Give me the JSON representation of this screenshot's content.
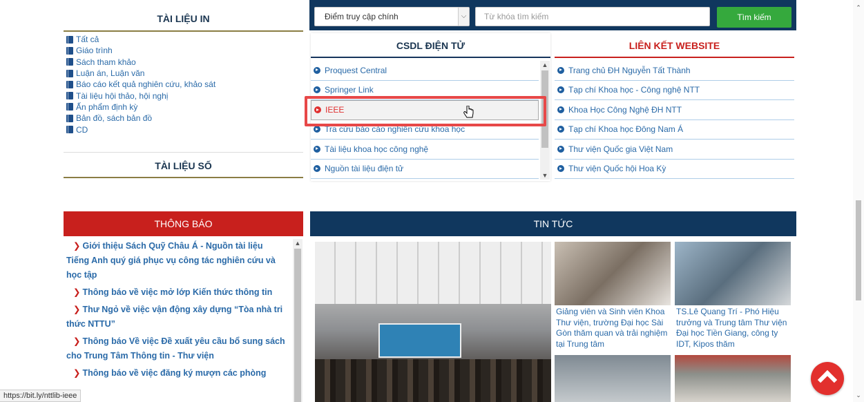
{
  "print_docs": {
    "title": "TÀI LIỆU IN",
    "items": [
      "Tất cả",
      "Giáo trình",
      "Sách tham khảo",
      "Luận án, Luận văn",
      "Báo cáo kết quả nghiên cứu, khảo sát",
      "Tài liệu hội thảo, hội nghị",
      "Ấn phẩm định kỳ",
      "Bản đồ, sách bản đồ",
      "CD"
    ]
  },
  "digital_docs": {
    "title": "TÀI LIỆU SỐ"
  },
  "search": {
    "scope_selected": "Điểm truy cập chính",
    "keyword_placeholder": "Từ khóa tìm kiếm",
    "button_label": "Tìm kiếm"
  },
  "csdl": {
    "title": "CSDL ĐIỆN TỬ",
    "items": [
      "Proquest Central",
      "Springer Link",
      "IEEE",
      "Tra cứu báo cáo nghiên cứu khoa học",
      "Tài liệu khoa học công nghệ",
      "Nguồn tài liệu điện tử"
    ],
    "highlighted": "IEEE"
  },
  "links": {
    "title": "LIÊN KẾT WEBSITE",
    "items": [
      "Trang chủ ĐH Nguyễn Tất Thành",
      "Tạp chí Khoa học - Công nghệ NTT",
      "Khoa Học Công Nghệ ĐH NTT",
      "Tạp chí Khoa học Đông Nam Á",
      "Thư viện Quốc gia Việt Nam",
      "Thư viện Quốc hội Hoa Kỳ"
    ]
  },
  "notices": {
    "title": "THÔNG BÁO",
    "items": [
      "Giới thiệu Sách Quỹ Châu Á - Nguồn tài liệu Tiếng Anh quý giá phục vụ công tác nghiên cứu và học tập",
      "Thông báo về việc mở lớp Kiến thức thông tin",
      "Thư Ngỏ về việc vận động xây dựng “Tòa nhà tri thức NTTU”",
      "Thông báo Về việc Đề xuất yêu cầu bổ sung sách cho Trung Tâm Thông tin - Thư viện",
      "Thông báo về việc đăng ký mượn các phòng"
    ]
  },
  "news": {
    "title": "TIN TỨC",
    "captions": [
      "Giảng viên và Sinh viên Khoa Thư viện, trường Đại học Sài Gòn thăm quan và trải nghiệm tại Trung tâm",
      "TS.Lê Quang Trí - Phó Hiệu trưởng và Trung tâm Thư viện Đại học Tiền Giang, công ty IDT, Kipos thăm"
    ]
  },
  "status_url": "https://bit.ly/nttlib-ieee",
  "colors": {
    "navy": "#10375e",
    "red": "#c8201d",
    "green": "#35a93d",
    "link": "#2a6aa8"
  },
  "icons": [
    "book-icon",
    "arrow-circle-icon",
    "chevron-right-icon",
    "hand-cursor-icon",
    "back-to-top-icon"
  ]
}
